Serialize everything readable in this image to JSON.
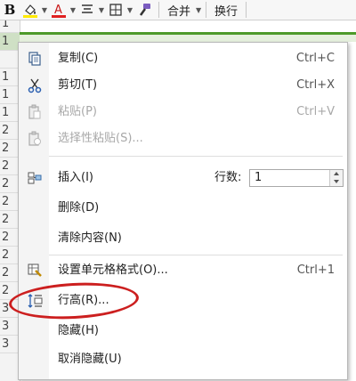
{
  "toolbar": {
    "bold": "B",
    "merge_label": "合并",
    "wrap_label": "换行",
    "icons": [
      "bold-icon",
      "fill-color-icon",
      "font-color-icon",
      "align-icon",
      "border-icon",
      "format-painter-icon"
    ],
    "accent_fill": "#ffea00",
    "accent_font": "#e02020"
  },
  "row_headers": [
    "1",
    "1",
    "",
    "1",
    "1",
    "1",
    "2",
    "2",
    "2",
    "2",
    "2",
    "2",
    "2",
    "2",
    "2",
    "2",
    "3",
    "3",
    "3"
  ],
  "context_menu": {
    "items": [
      {
        "label": "复制(C)",
        "shortcut": "Ctrl+C",
        "icon": "copy-icon",
        "enabled": true
      },
      {
        "label": "剪切(T)",
        "shortcut": "Ctrl+X",
        "icon": "cut-icon",
        "enabled": true
      },
      {
        "label": "粘贴(P)",
        "shortcut": "Ctrl+V",
        "icon": "paste-icon",
        "enabled": false
      },
      {
        "label": "选择性粘贴(S)...",
        "shortcut": "",
        "icon": "paste-special-icon",
        "enabled": false
      },
      {
        "label": "插入(I)",
        "shortcut": "",
        "icon": "insert-icon",
        "enabled": true
      },
      {
        "label": "删除(D)",
        "shortcut": "",
        "icon": "",
        "enabled": true
      },
      {
        "label": "清除内容(N)",
        "shortcut": "",
        "icon": "",
        "enabled": true
      },
      {
        "label": "设置单元格格式(O)...",
        "shortcut": "Ctrl+1",
        "icon": "format-cells-icon",
        "enabled": true
      },
      {
        "label": "行高(R)...",
        "shortcut": "",
        "icon": "row-height-icon",
        "enabled": true
      },
      {
        "label": "隐藏(H)",
        "shortcut": "",
        "icon": "",
        "enabled": true
      },
      {
        "label": "取消隐藏(U)",
        "shortcut": "",
        "icon": "",
        "enabled": true
      }
    ],
    "insert_rows": {
      "label": "行数:",
      "value": "1"
    },
    "annotation_color": "#cc1f1f"
  }
}
